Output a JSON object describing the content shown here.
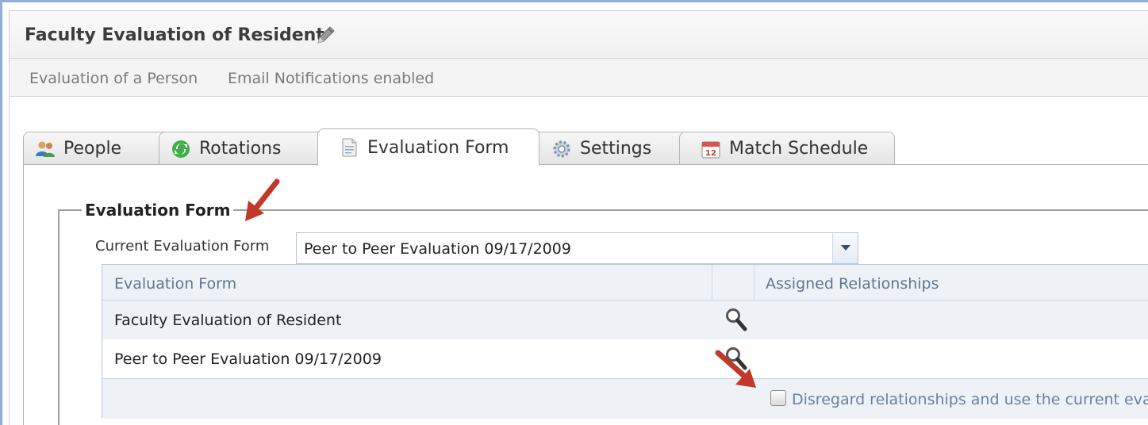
{
  "header": {
    "title": "Faculty Evaluation of Resident",
    "subtitle_items": [
      "Evaluation of a Person",
      "Email Notifications enabled"
    ]
  },
  "tabs": [
    {
      "label": "People",
      "icon": "people-icon",
      "active": false
    },
    {
      "label": "Rotations",
      "icon": "rotations-icon",
      "active": false
    },
    {
      "label": "Evaluation Form",
      "icon": "document-icon",
      "active": true
    },
    {
      "label": "Settings",
      "icon": "gear-icon",
      "active": false
    },
    {
      "label": "Match Schedule",
      "icon": "calendar-icon",
      "active": false
    }
  ],
  "evaluation_form": {
    "legend": "Evaluation Form",
    "current_label": "Current Evaluation Form",
    "current_value": "Peer to Peer Evaluation 09/17/2009",
    "columns": [
      "Evaluation Form",
      "Assigned Relationships"
    ],
    "rows": [
      {
        "name": "Faculty Evaluation of Resident"
      },
      {
        "name": "Peer to Peer Evaluation 09/17/2009"
      }
    ],
    "disregard_label": "Disregard relationships and use the current evalu",
    "disregard_checked": false
  },
  "colors": {
    "accent": "#8fb0d8",
    "arrow": "#c0392b",
    "row_alt": "#eef2f7"
  }
}
